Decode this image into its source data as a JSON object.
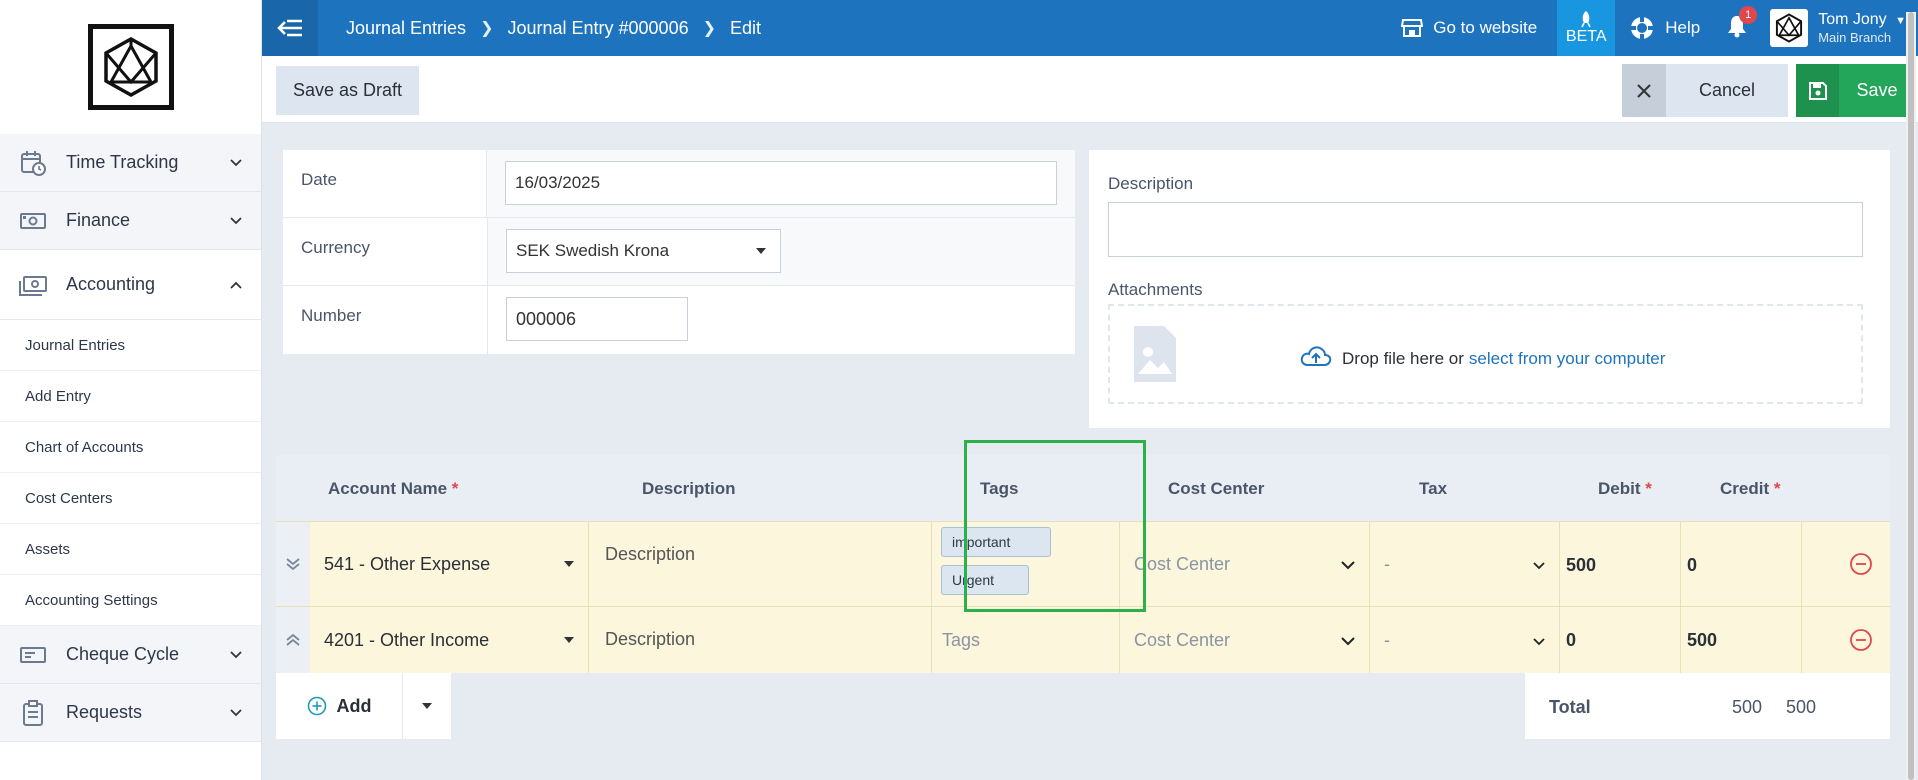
{
  "sidebar": {
    "items": [
      {
        "label": "Time Tracking",
        "icon": "calendar-clock-icon"
      },
      {
        "label": "Finance",
        "icon": "money-icon"
      },
      {
        "label": "Accounting",
        "icon": "cash-icon"
      }
    ],
    "subitems": [
      "Journal Entries",
      "Add Entry",
      "Chart of Accounts",
      "Cost Centers",
      "Assets",
      "Accounting Settings"
    ],
    "items_after": [
      {
        "label": "Cheque Cycle",
        "icon": "cheque-icon"
      },
      {
        "label": "Requests",
        "icon": "clipboard-icon"
      }
    ]
  },
  "topbar": {
    "breadcrumbs": [
      "Journal Entries",
      "Journal Entry #000006",
      "Edit"
    ],
    "go_to_website": "Go to website",
    "beta": "BETA",
    "help": "Help",
    "notifications_count": "1",
    "user_name": "Tom Jony",
    "user_branch": "Main Branch",
    "color_primary": "#1e73be"
  },
  "actions": {
    "save_draft": "Save as Draft",
    "cancel": "Cancel",
    "save": "Save",
    "save_color": "#23a55a"
  },
  "form": {
    "date_label": "Date",
    "date_value": "16/03/2025",
    "currency_label": "Currency",
    "currency_value": "SEK Swedish Krona",
    "number_label": "Number",
    "number_value": "000006"
  },
  "side_panel": {
    "description_label": "Description",
    "attachments_label": "Attachments",
    "drop_text": "Drop file here or",
    "drop_link": "select from your computer"
  },
  "table": {
    "headers": {
      "account": "Account Name",
      "description": "Description",
      "tags": "Tags",
      "cost_center": "Cost Center",
      "tax": "Tax",
      "debit": "Debit",
      "credit": "Credit",
      "required_mark": "*"
    },
    "rows": [
      {
        "account": "541 - Other Expense",
        "description": "Description",
        "tags": [
          "important",
          "Urgent"
        ],
        "cost_center": "Cost Center",
        "tax": "-",
        "debit": "500",
        "credit": "0"
      },
      {
        "account": "4201 - Other Income",
        "description": "Description",
        "tags_placeholder": "Tags",
        "cost_center": "Cost Center",
        "tax": "-",
        "debit": "0",
        "credit": "500"
      }
    ],
    "add_label": "Add",
    "total_label": "Total",
    "total_debit": "500",
    "total_credit": "500"
  }
}
